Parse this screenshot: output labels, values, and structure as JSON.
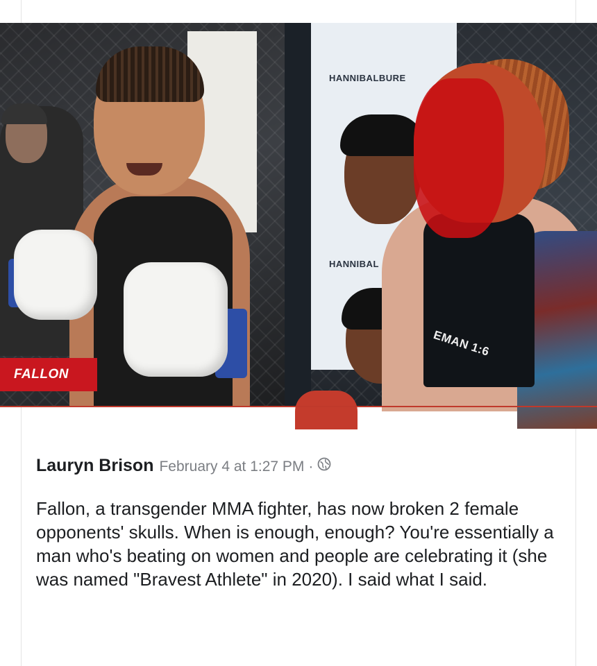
{
  "photo": {
    "left_label": "FALLON",
    "banner_text_top": "HANNIBALBURE",
    "banner_text_bottom": "HANNIBAL",
    "shirt_text": "EMAN 1:6"
  },
  "post": {
    "author": "Lauryn Brison",
    "timestamp": "February 4 at 1:27 PM",
    "separator": "·",
    "audience_icon": "globe-icon",
    "body": "Fallon, a transgender MMA fighter, has now broken 2 female opponents' skulls. When is enough, enough? You're essentially a man who's beating on women and people are celebrating it (she was named \"Bravest Athlete\" in 2020). I said what I said."
  },
  "colors": {
    "label_red": "#c9171f",
    "text_primary": "#1c1e21",
    "text_secondary": "#7b7e83"
  }
}
